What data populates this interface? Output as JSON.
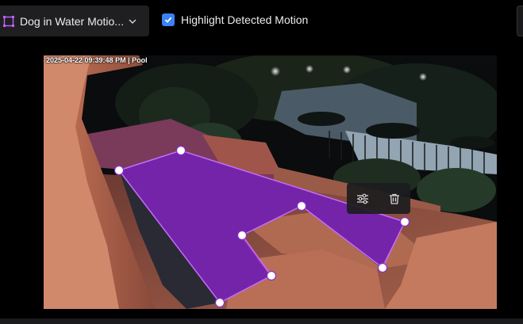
{
  "toolbar": {
    "zone_select_value": "Dog in Water Motio...",
    "highlight_checkbox_label": "Highlight Detected Motion",
    "highlight_checked": true
  },
  "camera_feed": {
    "timestamp_overlay": "2025-04-22 09:39:48 PM | Pool"
  },
  "zone": {
    "fill_color": "#a020f0",
    "stroke_color": "#c86bff",
    "handle_color": "#ffffff"
  },
  "zone_toolbar": {
    "buttons": [
      {
        "name": "adjust-settings-button",
        "icon": "sliders-icon"
      },
      {
        "name": "delete-zone-button",
        "icon": "trash-icon"
      }
    ]
  },
  "colors": {
    "accent": "#3b82f6",
    "dropdown_bg": "#1f1f22",
    "page_bg": "#000000"
  }
}
